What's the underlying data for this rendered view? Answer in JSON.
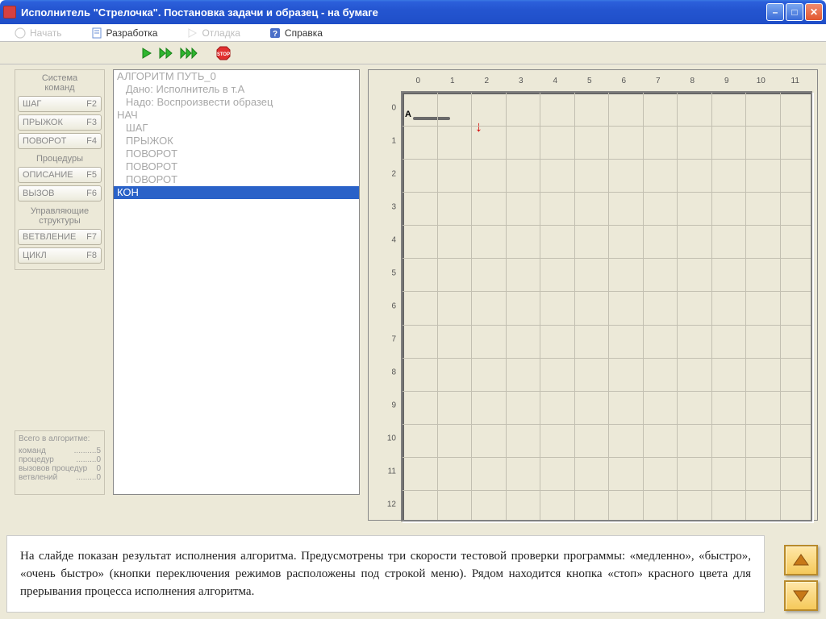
{
  "window": {
    "title": "Исполнитель \"Стрелочка\". Постановка задачи и образец - на бумаге"
  },
  "menu": {
    "start": "Начать",
    "dev": "Разработка",
    "debug": "Отладка",
    "help": "Справка"
  },
  "left_panel": {
    "header_l1": "Система",
    "header_l2": "команд",
    "cmds": [
      {
        "label": "ШАГ",
        "key": "F2"
      },
      {
        "label": "ПРЫЖОК",
        "key": "F3"
      },
      {
        "label": "ПОВОРОТ",
        "key": "F4"
      }
    ],
    "proc_header": "Процедуры",
    "procs": [
      {
        "label": "ОПИСАНИЕ",
        "key": "F5"
      },
      {
        "label": "ВЫЗОВ",
        "key": "F6"
      }
    ],
    "ctrl_header_l1": "Управляющие",
    "ctrl_header_l2": "структуры",
    "ctrls": [
      {
        "label": "ВЕТВЛЕНИЕ",
        "key": "F7"
      },
      {
        "label": "ЦИКЛ",
        "key": "F8"
      }
    ]
  },
  "stats": {
    "title": "Всего в алгоритме:",
    "rows": [
      {
        "k": "команд",
        "v": "5"
      },
      {
        "k": "процедур",
        "v": "0"
      },
      {
        "k": "вызовов процедур",
        "v": "0"
      },
      {
        "k": "ветвлений",
        "v": "0"
      }
    ]
  },
  "code": {
    "lines": [
      "АЛГОРИТМ ПУТЬ_0",
      "   Дано: Исполнитель в т.А",
      "   Надо: Воспроизвести образец",
      "НАЧ",
      "   ШАГ",
      "   ПРЫЖОК",
      "   ПОВОРОТ",
      "   ПОВОРОТ",
      "   ПОВОРОТ",
      "КОН"
    ],
    "selected_index": 9
  },
  "field": {
    "label_A": "А",
    "cols": 12,
    "rows": 13
  },
  "caption": "На слайде показан результат исполнения алгоритма. Предусмотрены три скорости тестовой проверки программы: «медленно», «быстро», «очень быстро» (кнопки переключения режимов расположены под строкой меню). Рядом находится кнопка «стоп» красного цвета для прерывания процесса исполнения алгоритма."
}
